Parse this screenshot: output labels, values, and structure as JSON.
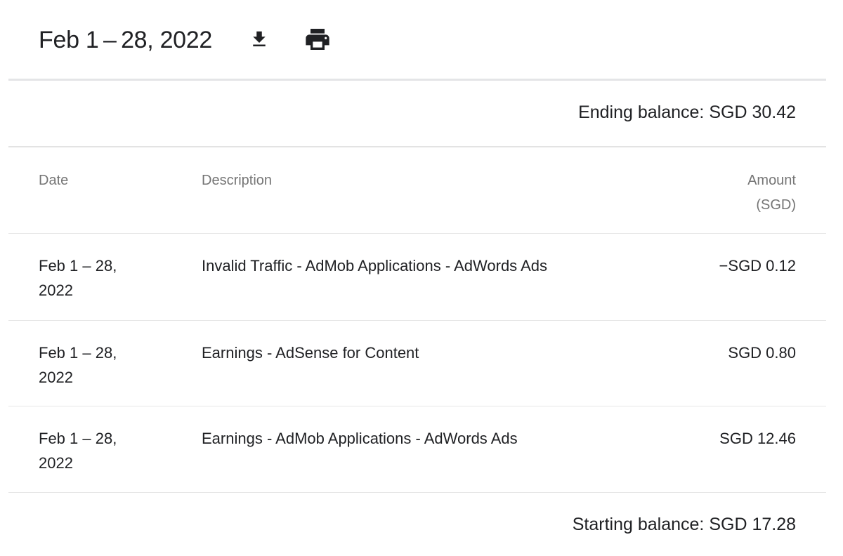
{
  "header": {
    "title": "Feb 1 – 28, 2022",
    "download_icon": "download-icon",
    "print_icon": "print-icon"
  },
  "ending_balance": "Ending balance: SGD 30.42",
  "table": {
    "columns": {
      "date": "Date",
      "description": "Description",
      "amount_line1": "Amount",
      "amount_line2": "(SGD)"
    },
    "rows": [
      {
        "date_line1": "Feb 1 – 28,",
        "date_line2": "2022",
        "description": "Invalid Traffic - AdMob Applications - AdWords Ads",
        "amount": "−SGD 0.12"
      },
      {
        "date_line1": "Feb 1 – 28,",
        "date_line2": "2022",
        "description": "Earnings - AdSense for Content",
        "amount": "SGD 0.80"
      },
      {
        "date_line1": "Feb 1 – 28,",
        "date_line2": "2022",
        "description": "Earnings - AdMob Applications - AdWords Ads",
        "amount": "SGD 12.46"
      }
    ]
  },
  "starting_balance": "Starting balance: SGD 17.28",
  "colors": {
    "text": "#202124",
    "muted": "#757575",
    "divider": "#e4e5e7"
  }
}
